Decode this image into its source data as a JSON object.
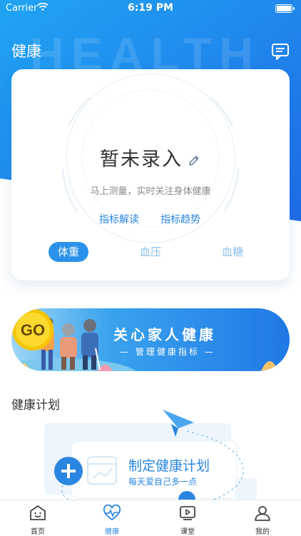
{
  "status_bar": {
    "carrier": "Carrier",
    "time": "6:19 PM"
  },
  "header": {
    "title": "健康",
    "watermark": "HEALTH"
  },
  "card": {
    "status_title": "暂未录入",
    "status_hint": "马上测量，实时关注身体健康",
    "links": [
      "指标解读",
      "指标趋势"
    ],
    "tabs": [
      "体重",
      "血压",
      "血糖"
    ],
    "active_tab": "体重"
  },
  "banner": {
    "title": "关心家人健康",
    "subtitle": "— 管理健康指标 —",
    "badge": "GO"
  },
  "plan": {
    "section_title": "健康计划",
    "card_title": "制定健康计划",
    "card_subtitle": "每天爱自己多一点"
  },
  "tabbar": {
    "items": [
      {
        "label": "首页",
        "icon": "smile-face-icon"
      },
      {
        "label": "健康",
        "icon": "heartbeat-icon"
      },
      {
        "label": "课堂",
        "icon": "video-icon"
      },
      {
        "label": "我的",
        "icon": "person-icon"
      }
    ],
    "active": "健康"
  },
  "colors": {
    "accent": "#2a86e0",
    "hero_start": "#1ba0f2",
    "hero_end": "#1f6fe8",
    "badge": "#f5c400"
  }
}
